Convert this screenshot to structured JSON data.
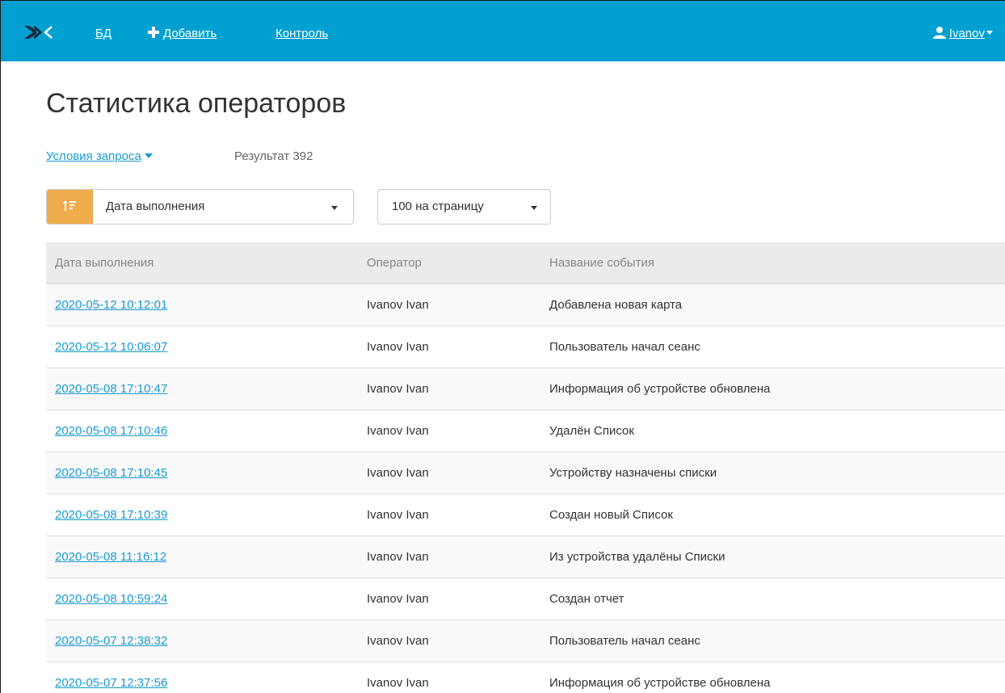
{
  "nav": {
    "bd_label": "БД",
    "add_label": "Добавить",
    "control_label": "Контроль",
    "user_label": "Ivanov"
  },
  "page": {
    "title": "Статистика операторов",
    "query_conditions_label": "Условия запроса",
    "result_label": "Результат 392"
  },
  "controls": {
    "sort_field": "Дата выполнения",
    "per_page": "100 на страницу"
  },
  "table": {
    "headers": [
      "Дата выполнения",
      "Оператор",
      "Название события"
    ],
    "rows": [
      {
        "date": "2020-05-12 10:12:01",
        "operator": "Ivanov Ivan",
        "event": "Добавлена новая карта"
      },
      {
        "date": "2020-05-12 10:06:07",
        "operator": "Ivanov Ivan",
        "event": "Пользователь начал сеанс"
      },
      {
        "date": "2020-05-08 17:10:47",
        "operator": "Ivanov Ivan",
        "event": "Информация об устройстве обновлена"
      },
      {
        "date": "2020-05-08 17:10:46",
        "operator": "Ivanov Ivan",
        "event": "Удалён Список"
      },
      {
        "date": "2020-05-08 17:10:45",
        "operator": "Ivanov Ivan",
        "event": "Устройству назначены списки"
      },
      {
        "date": "2020-05-08 17:10:39",
        "operator": "Ivanov Ivan",
        "event": "Создан новый Список"
      },
      {
        "date": "2020-05-08 11:16:12",
        "operator": "Ivanov Ivan",
        "event": "Из устройства удалёны Списки"
      },
      {
        "date": "2020-05-08 10:59:24",
        "operator": "Ivanov Ivan",
        "event": "Создан отчет"
      },
      {
        "date": "2020-05-07 12:38:32",
        "operator": "Ivanov Ivan",
        "event": "Пользователь начал сеанс"
      },
      {
        "date": "2020-05-07 12:37:56",
        "operator": "Ivanov Ivan",
        "event": "Информация об устройстве обновлена"
      }
    ]
  },
  "colors": {
    "navbar": "#00a0d1",
    "link": "#1a9ad1",
    "sort_button": "#f0ad4e",
    "header_bg": "#ebebeb"
  },
  "icons": {
    "logo": "logo-icon",
    "add": "plus-icon",
    "user": "user-icon",
    "sort": "sort-ascending-icon"
  }
}
